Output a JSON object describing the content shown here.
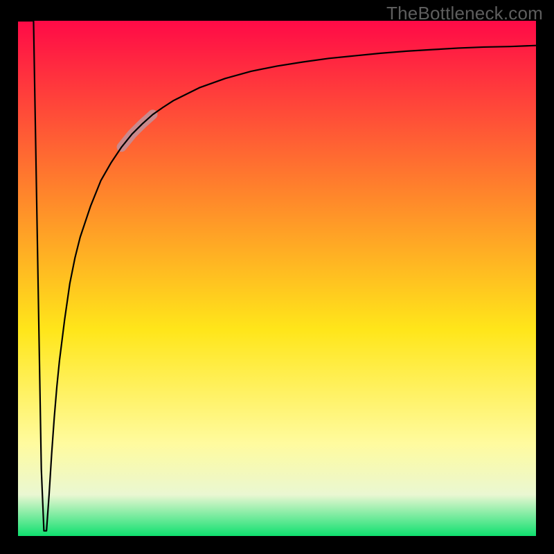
{
  "watermark": "TheBottleneck.com",
  "colors": {
    "frame": "#000000",
    "watermark_text": "#5e5e5e",
    "curve": "#000000",
    "highlight": "#c9898d",
    "gradient": {
      "top": "#ff0a47",
      "mid_upper": "#ff8a2a",
      "mid": "#ffe61a",
      "lower": "#fffb9e",
      "haze": "#eaf7d2",
      "bottom": "#0fe06f"
    }
  },
  "chart_data": {
    "type": "line",
    "title": "",
    "xlabel": "",
    "ylabel": "",
    "xlim": [
      0,
      100
    ],
    "ylim": [
      0,
      100
    ],
    "x": [
      0,
      3,
      4.5,
      5,
      5.5,
      6,
      6.5,
      7,
      7.5,
      8,
      9,
      10,
      11,
      12,
      14,
      16,
      18,
      20,
      22,
      24,
      26,
      28,
      30,
      35,
      40,
      45,
      50,
      55,
      60,
      65,
      70,
      75,
      80,
      85,
      90,
      95,
      100
    ],
    "values": [
      100,
      100,
      13,
      1,
      1,
      8,
      16,
      23,
      29,
      34,
      42,
      49,
      54,
      58,
      64,
      69,
      72.5,
      75.5,
      78,
      80,
      81.8,
      83.2,
      84.5,
      87,
      88.8,
      90.2,
      91.2,
      92.0,
      92.7,
      93.2,
      93.7,
      94.1,
      94.4,
      94.7,
      94.9,
      95.0,
      95.2
    ],
    "highlight_segment": {
      "x_start": 20,
      "x_end": 26
    },
    "notes": "Values derived from pixel geometry; y measured as fraction of plot height from bottom edge. Origin at bottom-left of gradient area."
  }
}
